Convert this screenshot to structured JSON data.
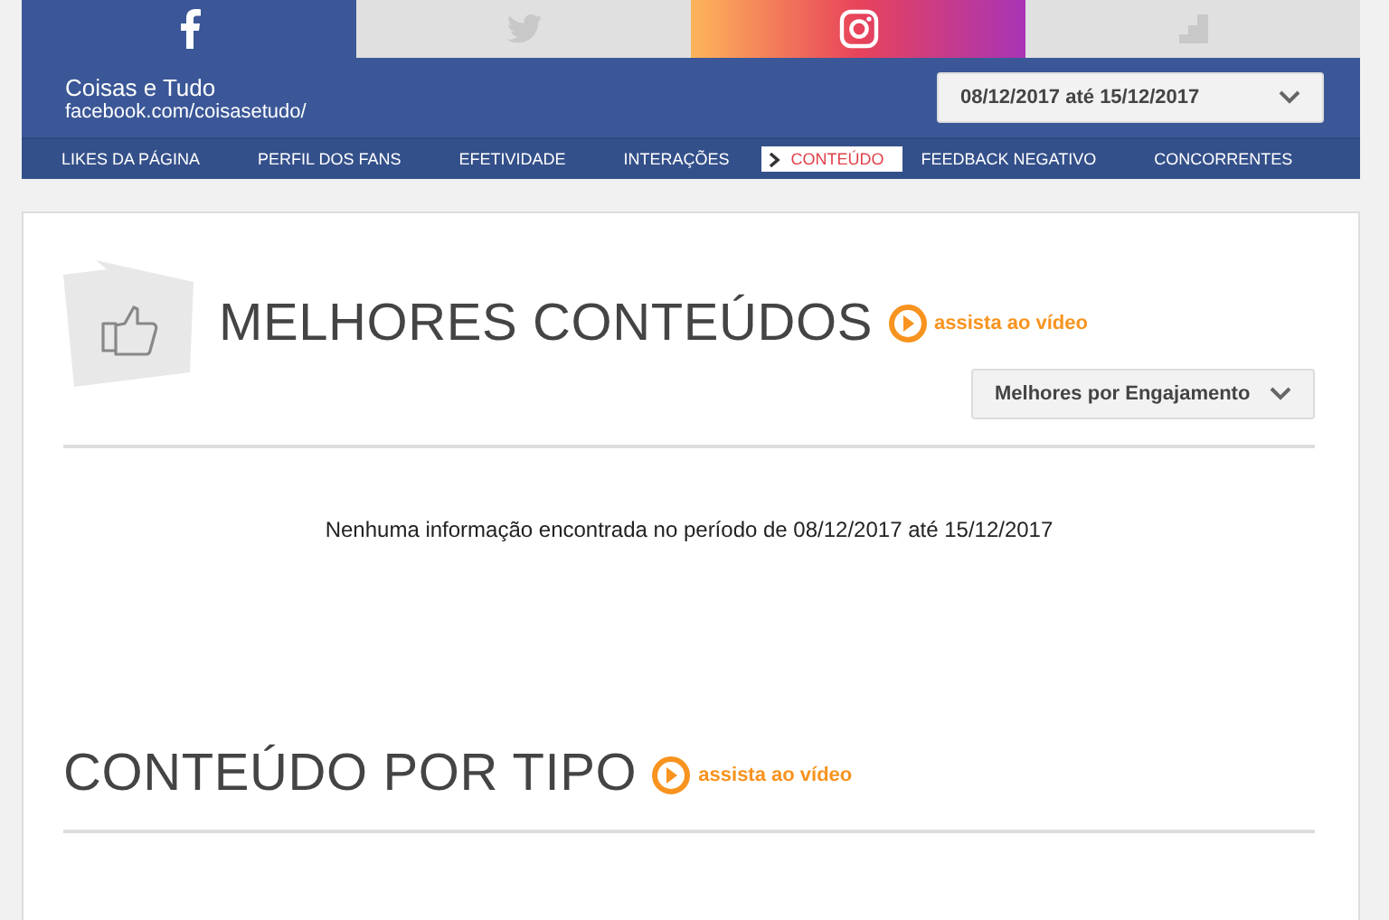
{
  "network_tabs": [
    {
      "kind": "facebook",
      "selected": true
    },
    {
      "kind": "twitter",
      "selected": false
    },
    {
      "kind": "instagram",
      "selected": false
    },
    {
      "kind": "chart",
      "selected": false
    }
  ],
  "profile": {
    "name": "Coisas e Tudo",
    "url": "facebook.com/coisasetudo/"
  },
  "date_range": "08/12/2017 até 15/12/2017",
  "nav": [
    {
      "label": "LIKES DA PÁGINA",
      "selected": false
    },
    {
      "label": "PERFIL DOS FANS",
      "selected": false
    },
    {
      "label": "EFETIVIDADE",
      "selected": false
    },
    {
      "label": "INTERAÇÕES",
      "selected": false
    },
    {
      "label": "CONTEÚDO",
      "selected": true
    },
    {
      "label": "FEEDBACK NEGATIVO",
      "selected": false
    },
    {
      "label": "CONCORRENTES",
      "selected": false
    }
  ],
  "sections": [
    {
      "title": "MELHORES CONTEÚDOS",
      "video_link": "assista ao vídeo",
      "sort": "Melhores por Engajamento",
      "message": "Nenhuma informação encontrada no período de 08/12/2017 até 15/12/2017"
    },
    {
      "title": "CONTEÚDO POR TIPO",
      "video_link": "assista ao vídeo"
    }
  ]
}
